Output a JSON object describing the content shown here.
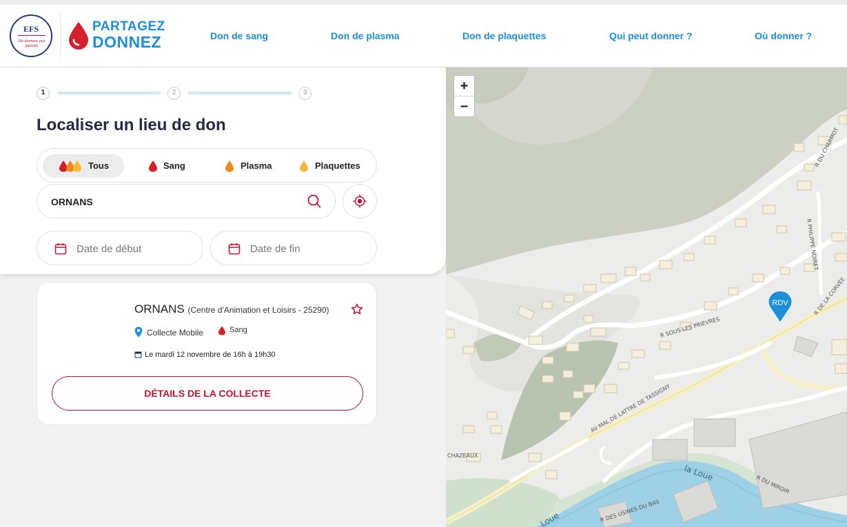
{
  "header": {
    "efs_logo_text": "EFS",
    "efs_tagline": "Du donneur aux patients",
    "brand_line1": "PARTAGEZ",
    "brand_line2": "DONNEZ",
    "nav": [
      "Don de sang",
      "Don de plasma",
      "Don de plaquettes",
      "Qui peut donner ?",
      "Où donner ?"
    ]
  },
  "steps": [
    "1",
    "2",
    "3"
  ],
  "search_panel": {
    "title": "Localiser un lieu de don",
    "filters": [
      {
        "label": "Tous",
        "active": true
      },
      {
        "label": "Sang",
        "active": false
      },
      {
        "label": "Plasma",
        "active": false
      },
      {
        "label": "Plaquettes",
        "active": false
      }
    ],
    "search_value": "ORNANS",
    "date_start_placeholder": "Date de début",
    "date_end_placeholder": "Date de fin"
  },
  "result": {
    "city": "ORNANS",
    "place": "(Centre d'Animation et Loisirs - 25290)",
    "type": "Collecte Mobile",
    "donation": "Sang",
    "date": "Le mardi 12 novembre de 16h à 19h30",
    "button": "DÉTAILS DE LA COLLECTE"
  },
  "map": {
    "zoom_in": "+",
    "zoom_out": "−",
    "pin_label": "RDV",
    "street_labels": [
      "R DU CHARMOT",
      "R PHILIPPE NOIRET",
      "R DE LA CORVÉE",
      "R SOUS LES PRIEVRES",
      "AV MAL DE LATTRE DE TASSIGNY",
      "CHAZEAUX",
      "la Loue",
      "R DU MIROIR",
      "R DES USINES DU BAS",
      "Loue"
    ]
  },
  "colors": {
    "brand_blue": "#1b8fd8",
    "blood_red": "#d3202a",
    "plasma_orange": "#f08a1c",
    "platelet_yellow": "#f6b93b"
  }
}
